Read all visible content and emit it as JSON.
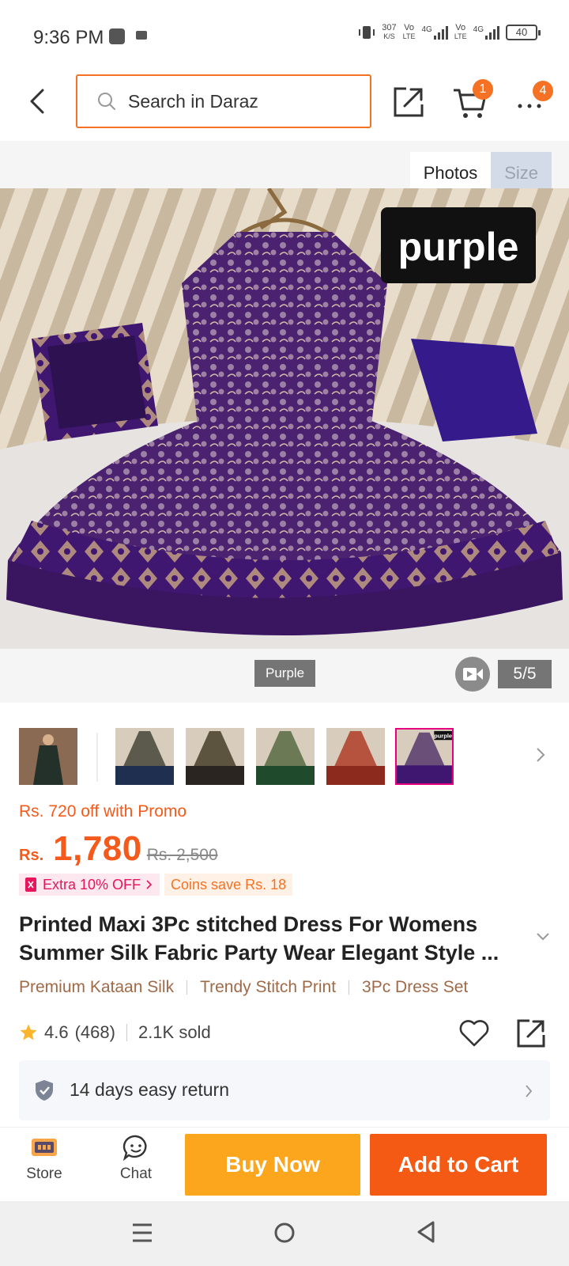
{
  "status_bar": {
    "time": "9:36 PM",
    "speed_value": "307",
    "speed_unit": "K/S",
    "network_1": "Vo",
    "network_1_sub": "LTE",
    "network_2": "Vo",
    "network_2_sub": "LTE",
    "gen_label": "4G",
    "battery": "40"
  },
  "header": {
    "search_placeholder": "Search in Daraz",
    "cart_badge": "1",
    "more_badge": "4"
  },
  "gallery": {
    "tabs": [
      {
        "label": "Photos",
        "active": true
      },
      {
        "label": "Size",
        "active": false
      }
    ],
    "image_label": "purple",
    "caption": "Purple",
    "counter": "5/5",
    "thumb_tag": "purple"
  },
  "price": {
    "promo": "Rs. 720 off with Promo",
    "currency": "Rs.",
    "current": "1,780",
    "original": "Rs. 2,500",
    "tag_extra": "Extra 10% OFF",
    "tag_coins": "Coins save Rs. 18"
  },
  "product": {
    "title": "Printed Maxi 3Pc stitched Dress For Womens Summer Silk Fabric Party Wear Elegant Style ...",
    "features": [
      "Premium Kataan Silk",
      "Trendy Stitch Print",
      "3Pc Dress Set"
    ],
    "rating": "4.6",
    "reviews": "(468)",
    "sold": "2.1K sold"
  },
  "return_policy": {
    "text": "14 days easy return"
  },
  "actions": {
    "store": "Store",
    "chat": "Chat",
    "buy_now": "Buy Now",
    "add_to_cart": "Add to Cart"
  },
  "colors": {
    "accent": "#f57224",
    "buy_now": "#fba61d",
    "add_to_cart": "#f45a14",
    "dress_purple": "#4a2270"
  }
}
